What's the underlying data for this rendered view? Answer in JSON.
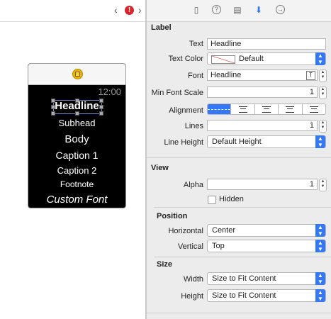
{
  "canvas": {
    "watch": {
      "clock": "12:00",
      "labels": [
        "Headline",
        "Subhead",
        "Body",
        "Caption 1",
        "Caption 2",
        "Footnote",
        "Custom Font"
      ]
    }
  },
  "inspector": {
    "label_section": {
      "title": "Label",
      "text_label": "Text",
      "text_value": "Headline",
      "text_color_label": "Text Color",
      "text_color_value": "Default",
      "font_label": "Font",
      "font_value": "Headline",
      "min_font_scale_label": "Min Font Scale",
      "min_font_scale_value": "1",
      "alignment_label": "Alignment",
      "lines_label": "Lines",
      "lines_value": "1",
      "line_height_label": "Line Height",
      "line_height_value": "Default Height"
    },
    "view_section": {
      "title": "View",
      "alpha_label": "Alpha",
      "alpha_value": "1",
      "hidden_label": "Hidden"
    },
    "position_section": {
      "title": "Position",
      "horizontal_label": "Horizontal",
      "horizontal_value": "Center",
      "vertical_label": "Vertical",
      "vertical_value": "Top"
    },
    "size_section": {
      "title": "Size",
      "width_label": "Width",
      "width_value": "Size to Fit Content",
      "height_label": "Height",
      "height_value": "Size to Fit Content"
    }
  }
}
